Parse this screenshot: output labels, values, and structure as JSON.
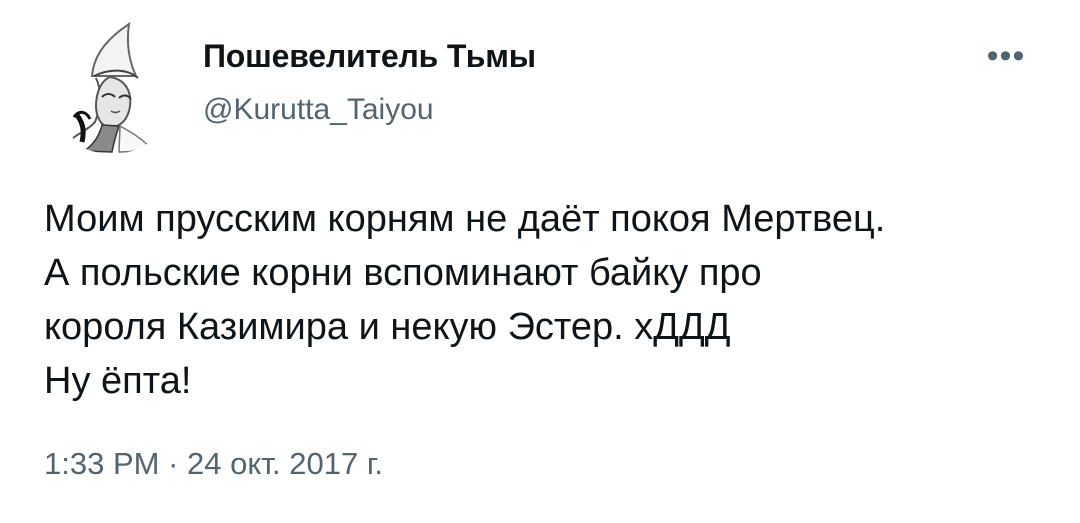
{
  "user": {
    "display_name": "Пошевелитель Тьмы",
    "handle": "@Kurutta_Taiyou",
    "avatar_icon": "anime-avatar-icon"
  },
  "actions": {
    "more_icon": "more-icon",
    "more_label": "•••"
  },
  "tweet": {
    "lines": [
      "Моим прусским корням не даёт покоя Мертвец.",
      "А польские корни вспоминают байку про",
      "короля Казимира и некую Эстер. хДДД",
      "Ну ёпта!"
    ],
    "time": "1:33 PM",
    "separator": "·",
    "date": "24 окт. 2017 г."
  },
  "colors": {
    "text": "#0f1419",
    "secondary": "#536471",
    "background": "#ffffff"
  }
}
